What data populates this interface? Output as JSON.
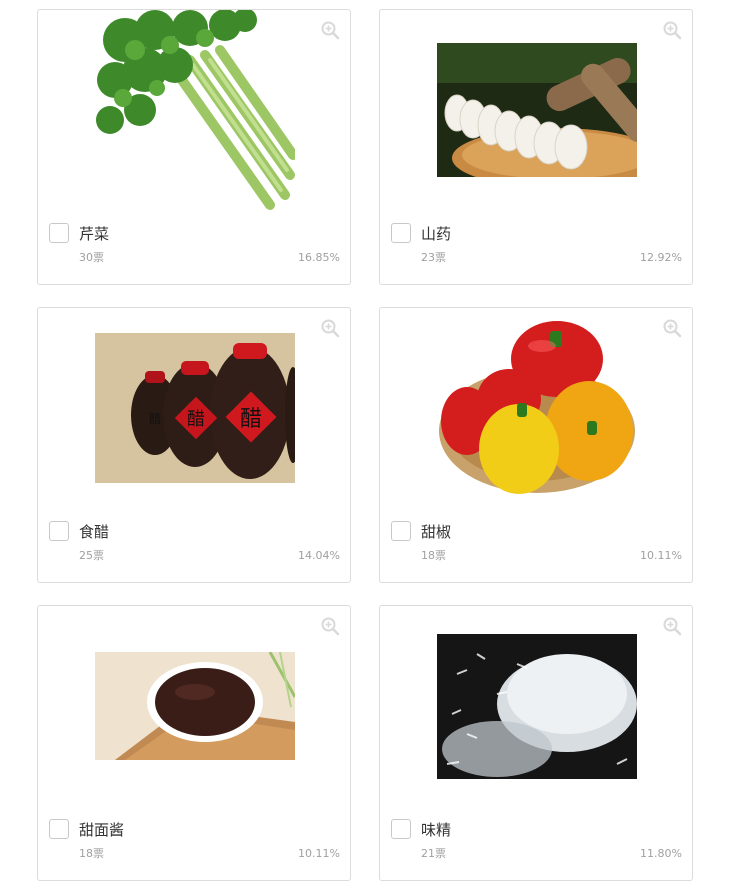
{
  "items": [
    {
      "name": "芹菜",
      "votes": "30票",
      "percent": "16.85%"
    },
    {
      "name": "山药",
      "votes": "23票",
      "percent": "12.92%"
    },
    {
      "name": "食醋",
      "votes": "25票",
      "percent": "14.04%"
    },
    {
      "name": "甜椒",
      "votes": "18票",
      "percent": "10.11%"
    },
    {
      "name": "甜面酱",
      "votes": "18票",
      "percent": "10.11%"
    },
    {
      "name": "味精",
      "votes": "21票",
      "percent": "11.80%"
    }
  ],
  "icons": {
    "zoom": "zoom-in-icon",
    "checkbox": "checkbox"
  },
  "colors": {
    "border": "#dcdcdc",
    "text": "#333333",
    "muted": "#a0a0a0"
  }
}
